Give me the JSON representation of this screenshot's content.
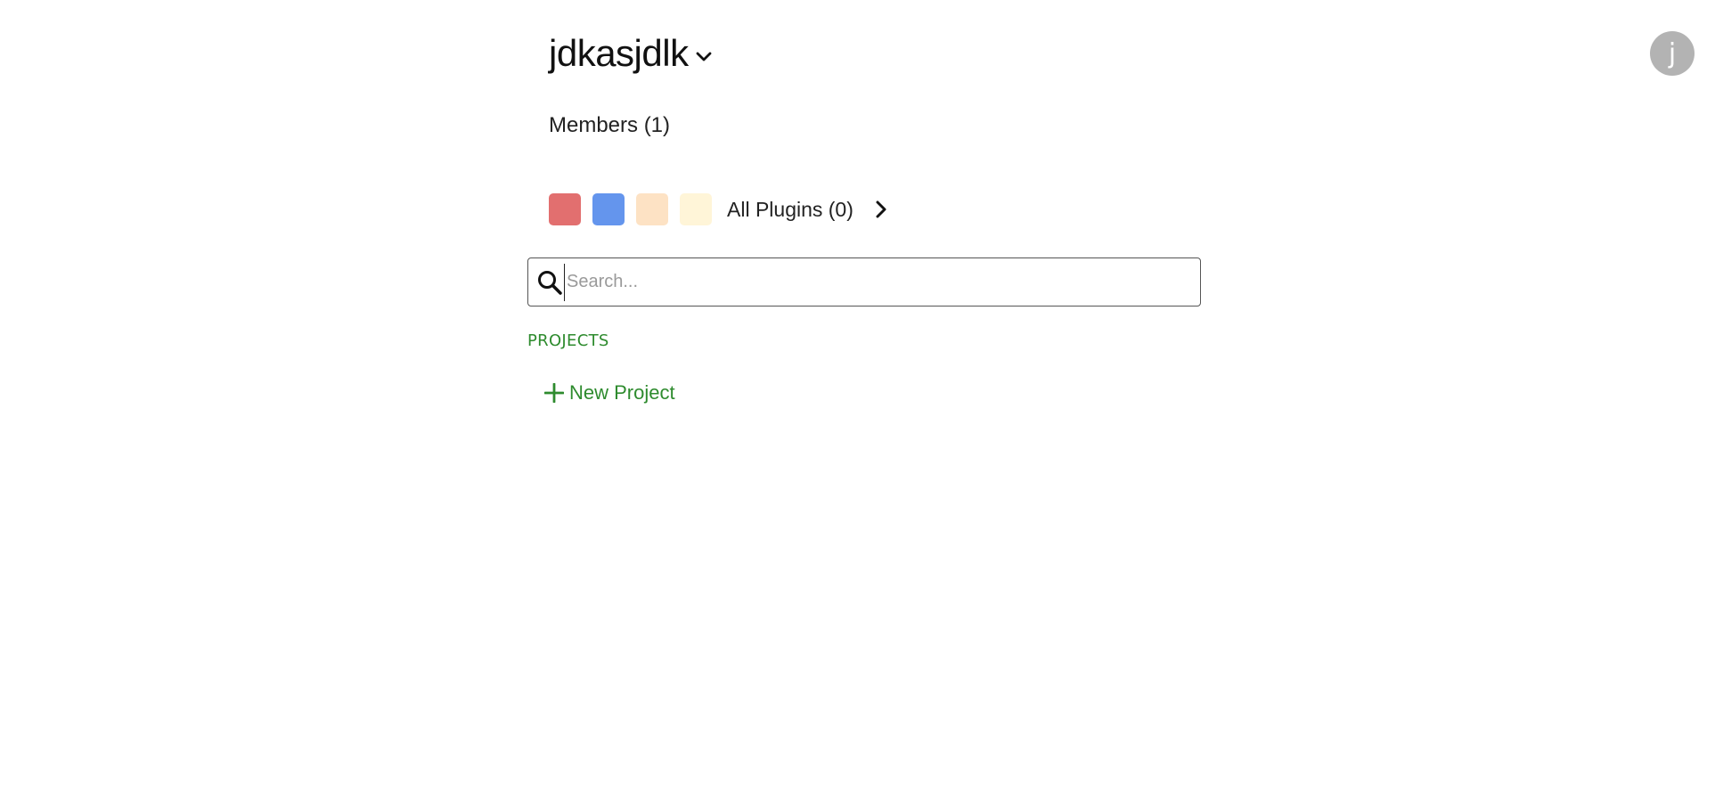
{
  "workspace": {
    "name": "jdkasjdlk",
    "dropdown_icon": "chevron-down-icon"
  },
  "members": {
    "label": "Members (1)"
  },
  "plugins": {
    "swatches": [
      {
        "color": "#e26f6f"
      },
      {
        "color": "#6495ed"
      },
      {
        "color": "#fde2c4"
      },
      {
        "color": "#fff5d8"
      }
    ],
    "label": "All Plugins (0)",
    "arrow_icon": "chevron-right-icon"
  },
  "search": {
    "placeholder": "Search...",
    "value": "",
    "icon": "search-icon"
  },
  "projects": {
    "section_label": "PROJECTS",
    "new_project_label": "New Project",
    "new_project_icon": "plus-icon",
    "accent_color": "#2e8b2e"
  },
  "user": {
    "avatar_initial": "j",
    "avatar_color": "#b3b3b3"
  }
}
